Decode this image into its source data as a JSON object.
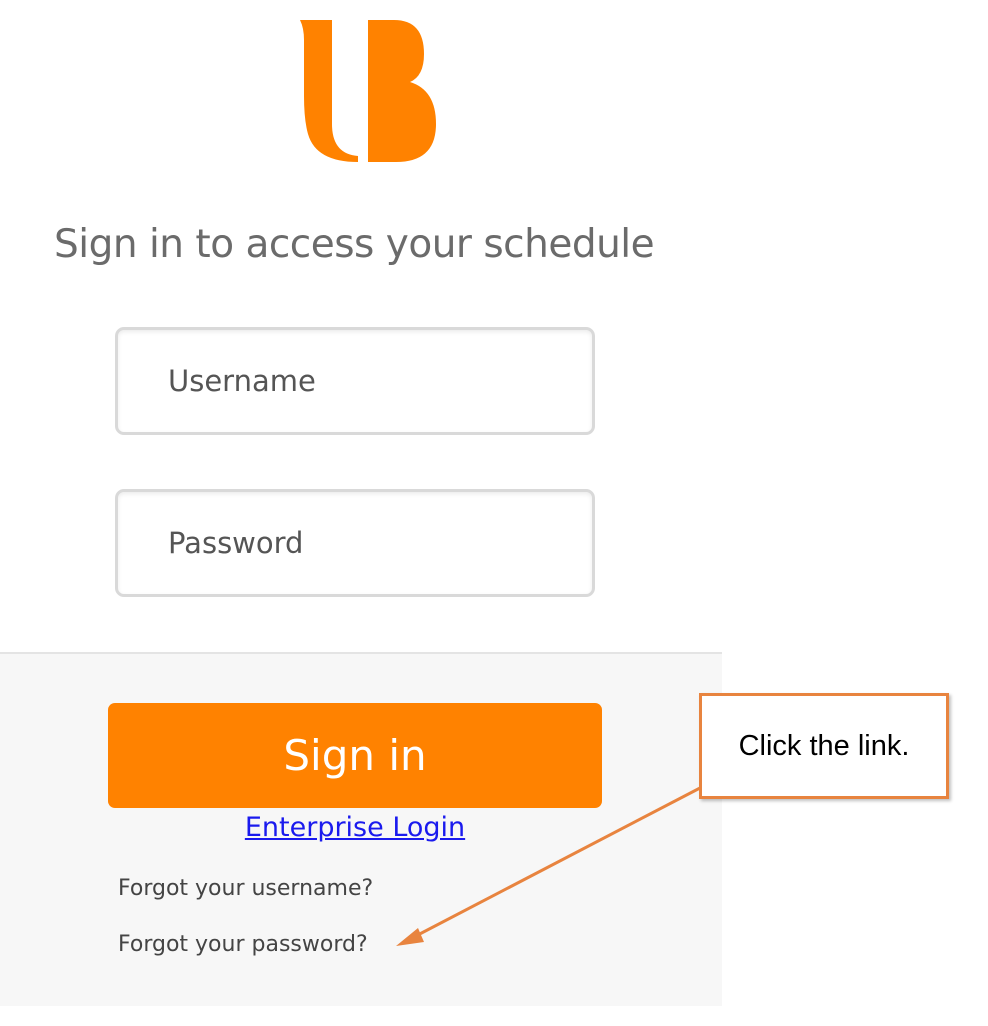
{
  "brand": {
    "logo_icon": "letter-b-logo-icon",
    "accent_color": "#ff8200"
  },
  "login": {
    "heading": "Sign in to access your schedule",
    "username_placeholder": "Username",
    "password_placeholder": "Password",
    "sign_in_label": "Sign in",
    "enterprise_login_label": "Enterprise Login",
    "forgot_username_label": "Forgot your username?",
    "forgot_password_label": "Forgot your password?"
  },
  "annotation": {
    "callout_text": "Click the link.",
    "callout_border_color": "#e8843f",
    "arrow_color": "#e8843f"
  }
}
